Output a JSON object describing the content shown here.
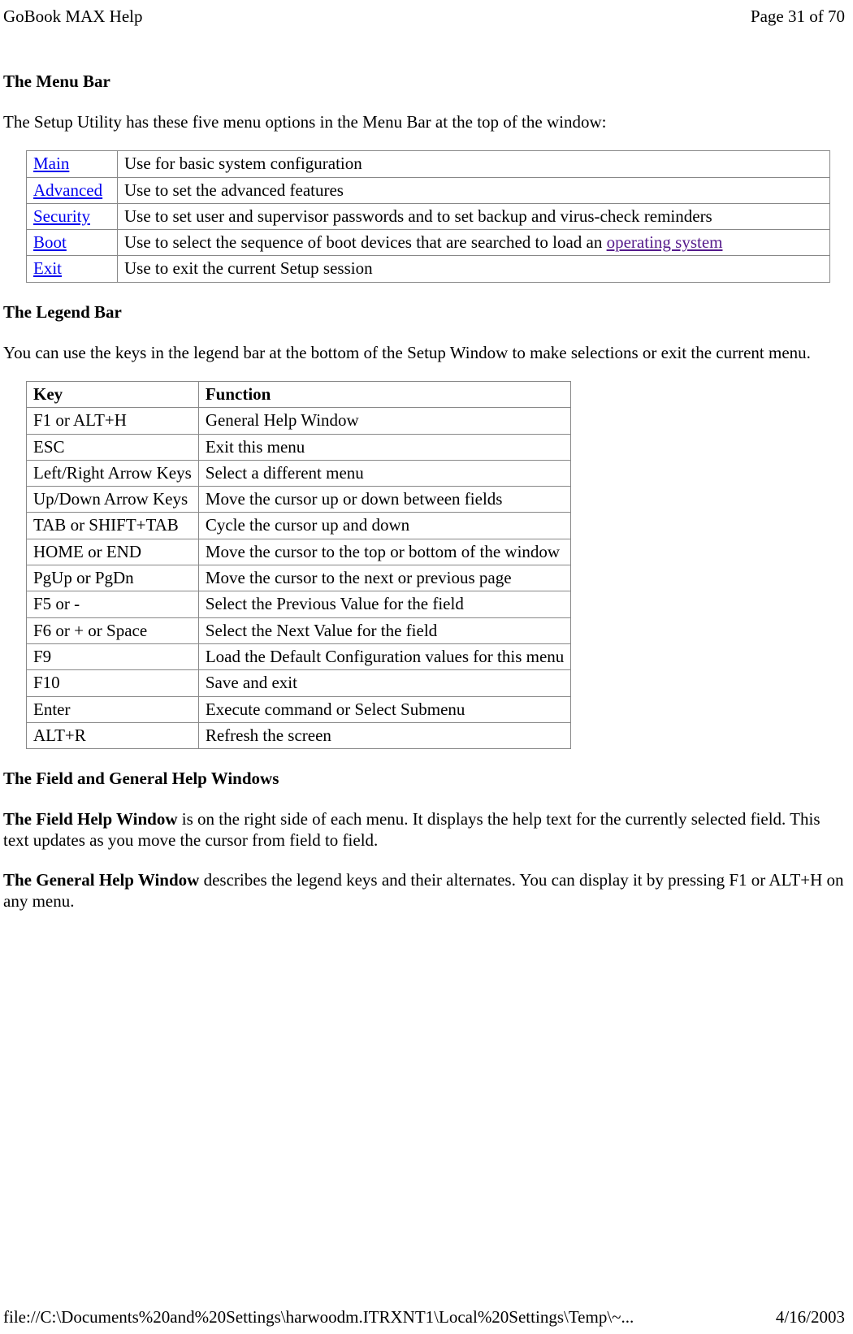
{
  "header": {
    "title": "GoBook MAX Help",
    "page_indicator": "Page 31 of 70"
  },
  "footer": {
    "path": "file://C:\\Documents%20and%20Settings\\harwoodm.ITRXNT1\\Local%20Settings\\Temp\\~...",
    "date": "4/16/2003"
  },
  "sections": {
    "menu_bar": {
      "heading": "The Menu Bar",
      "intro": "The Setup Utility has these five menu options in the Menu Bar at the top of the window:",
      "rows": [
        {
          "name": "Main",
          "desc": "Use for basic system configuration"
        },
        {
          "name": "Advanced",
          "desc": "Use to set the advanced features"
        },
        {
          "name": "Security",
          "desc": "Use to set user and supervisor passwords and to set backup and virus-check reminders"
        },
        {
          "name": "Boot",
          "desc_pre": "Use to select the sequence of boot devices that are searched to load an ",
          "link": "operating system"
        },
        {
          "name": "Exit",
          "desc": "Use to exit the current Setup session"
        }
      ]
    },
    "legend_bar": {
      "heading": "The Legend Bar",
      "intro": "You can use the keys in the legend bar at the bottom of the Setup Window to make selections or exit the current menu.",
      "header_key": "Key",
      "header_function": "Function",
      "rows": [
        {
          "key": "F1 or ALT+H",
          "func": "General Help Window"
        },
        {
          "key": "ESC",
          "func": "Exit this menu"
        },
        {
          "key": "Left/Right Arrow Keys",
          "func": "Select a different menu"
        },
        {
          "key": "Up/Down Arrow Keys",
          "func": "Move the cursor up or down between fields"
        },
        {
          "key": "TAB or SHIFT+TAB",
          "func": "Cycle the cursor up and down"
        },
        {
          "key": "HOME or END",
          "func": "Move the cursor to the top or bottom of the window"
        },
        {
          "key": "PgUp or PgDn",
          "func": "Move the cursor to the next or previous page"
        },
        {
          "key": "F5 or -",
          "func": "Select the Previous Value for the field"
        },
        {
          "key": "F6 or + or Space",
          "func": "Select the Next Value for the field"
        },
        {
          "key": "F9",
          "func": "Load the Default Configuration values for this menu"
        },
        {
          "key": "F10",
          "func": "Save and exit"
        },
        {
          "key": "Enter",
          "func": "Execute command or Select Submenu"
        },
        {
          "key": "ALT+R",
          "func": "Refresh the screen"
        }
      ]
    },
    "help_windows": {
      "heading": "The Field and General Help Windows",
      "p1_bold": "The Field Help Window",
      "p1_rest": " is on the right side of each menu.  It displays the help text for the currently selected field.  This text updates as you move the cursor from field to field.",
      "p2_bold": "The General Help Window",
      "p2_rest": " describes the legend keys and their alternates.  You can display it by pressing F1 or ALT+H on any menu."
    }
  }
}
